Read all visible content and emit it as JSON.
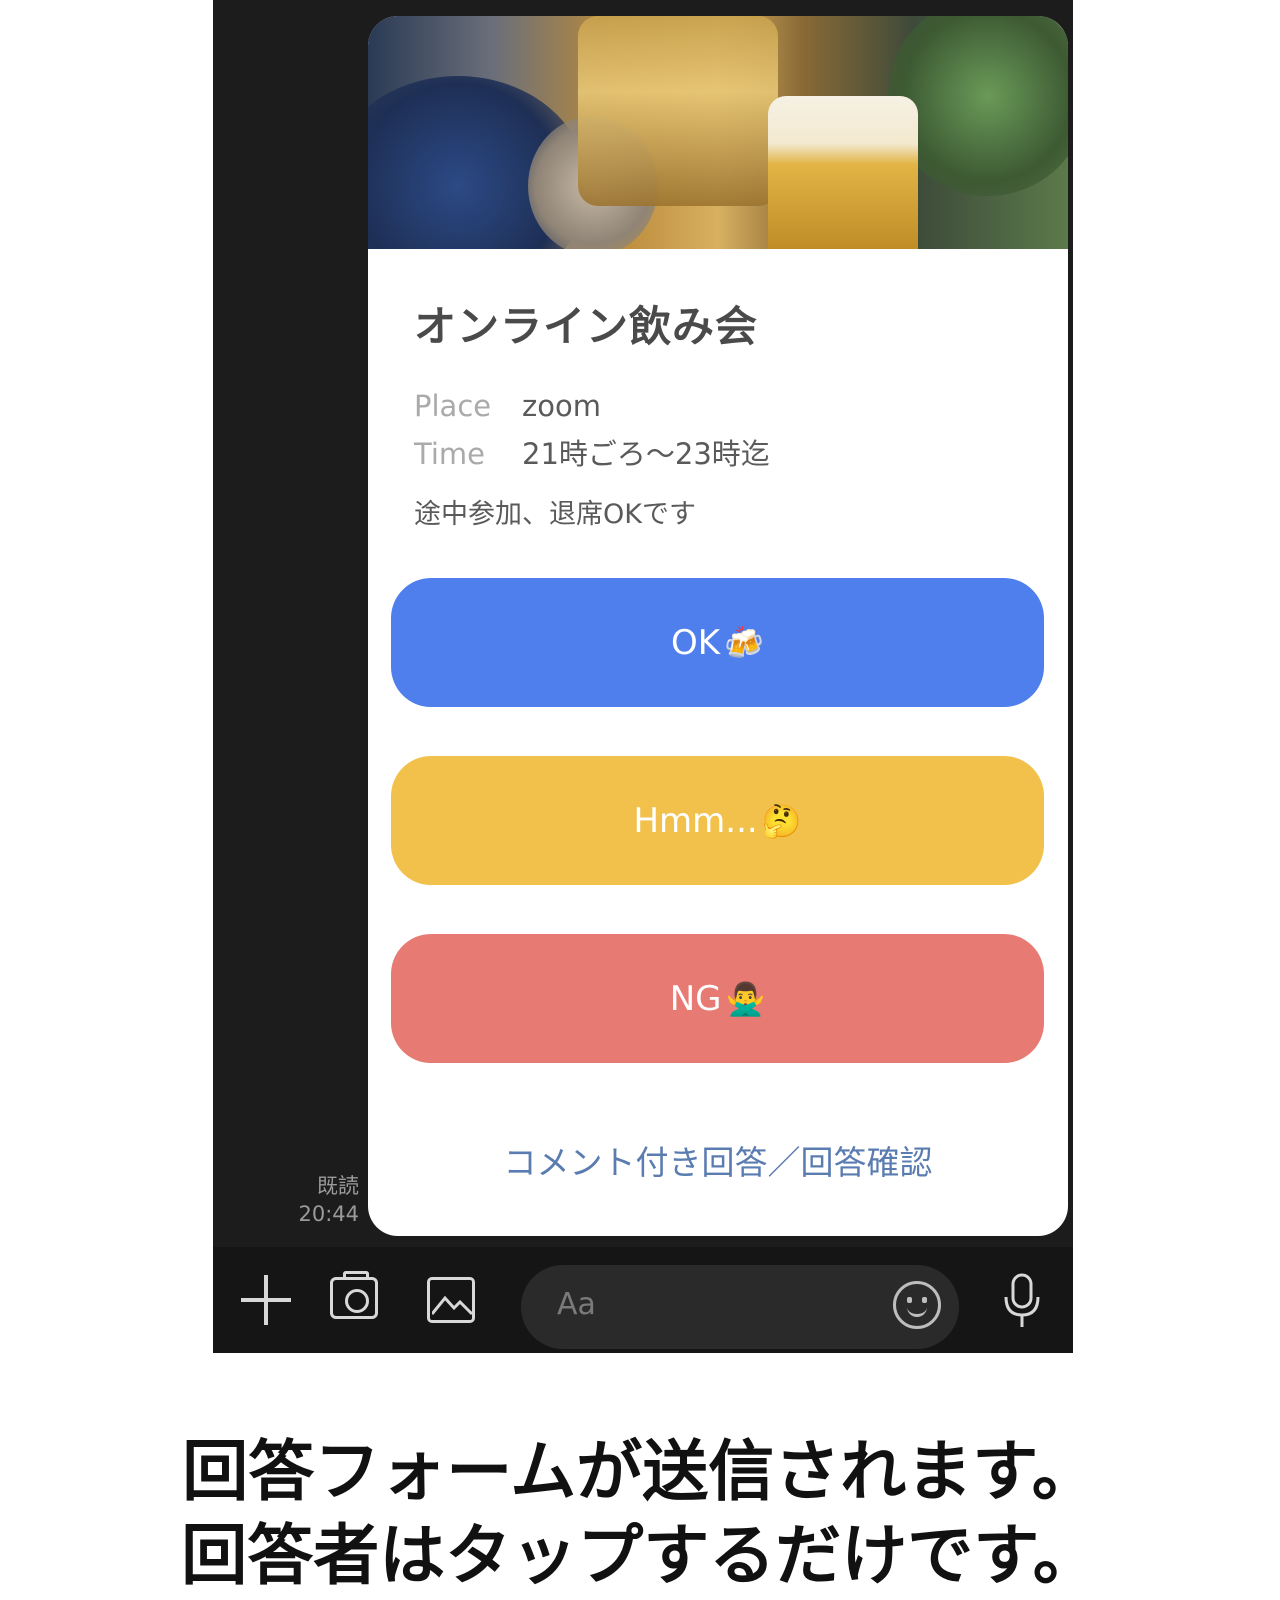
{
  "read_status": {
    "label": "既読",
    "time": "20:44"
  },
  "card": {
    "title": "オンライン飲み会",
    "details": [
      {
        "label": "Place",
        "value": "zoom"
      },
      {
        "label": "Time",
        "value": "21時ごろ〜23時迄"
      }
    ],
    "note": "途中参加、退席OKです",
    "buttons": {
      "ok": {
        "label": "OK",
        "emoji": "🍻",
        "color": "#4e7fec"
      },
      "hmm": {
        "label": "Hmm...",
        "emoji": "🤔",
        "color": "#f1c14b"
      },
      "ng": {
        "label": "NG",
        "emoji": "🙅‍♂️",
        "color": "#e77a72"
      }
    },
    "comment_link": "コメント付き回答／回答確認"
  },
  "input_bar": {
    "placeholder": "Aa"
  },
  "icons": [
    "plus-icon",
    "camera-icon",
    "image-icon",
    "smile-icon",
    "mic-icon"
  ],
  "caption": {
    "line1": "回答フォームが送信されます。",
    "line2": "回答者はタップするだけです。"
  }
}
